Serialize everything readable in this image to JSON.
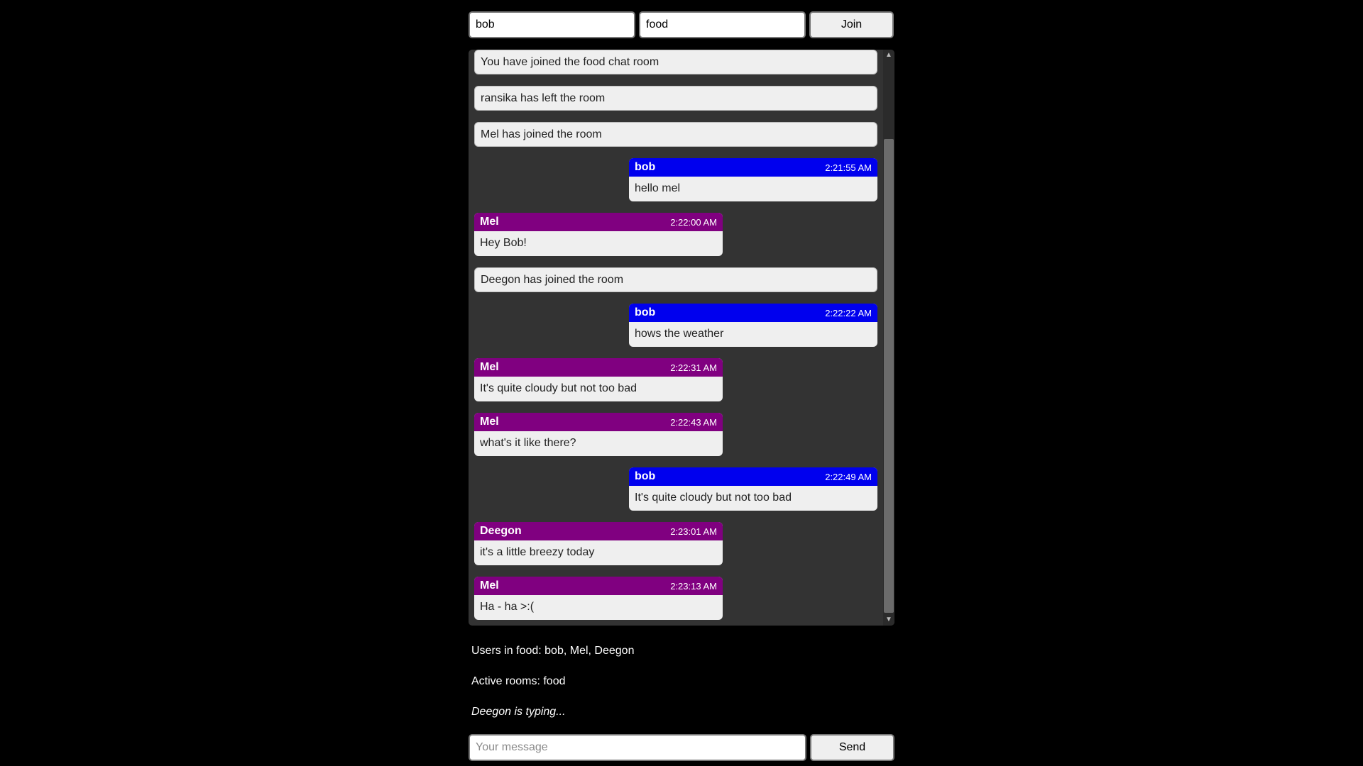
{
  "join": {
    "username_value": "bob",
    "room_value": "food",
    "join_label": "Join"
  },
  "messages": [
    {
      "kind": "notice",
      "text": "You have joined the food chat room"
    },
    {
      "kind": "notice",
      "text": "ransika has left the room"
    },
    {
      "kind": "notice",
      "text": "Mel has joined the room"
    },
    {
      "kind": "message",
      "side": "mine",
      "sender": "bob",
      "time": "2:21:55 AM",
      "text": "hello mel"
    },
    {
      "kind": "message",
      "side": "theirs",
      "sender": "Mel",
      "time": "2:22:00 AM",
      "text": "Hey Bob!"
    },
    {
      "kind": "notice",
      "text": "Deegon has joined the room"
    },
    {
      "kind": "message",
      "side": "mine",
      "sender": "bob",
      "time": "2:22:22 AM",
      "text": "hows the weather"
    },
    {
      "kind": "message",
      "side": "theirs",
      "sender": "Mel",
      "time": "2:22:31 AM",
      "text": "It's quite cloudy but not too bad"
    },
    {
      "kind": "message",
      "side": "theirs",
      "sender": "Mel",
      "time": "2:22:43 AM",
      "text": "what's it like there?"
    },
    {
      "kind": "message",
      "side": "mine",
      "sender": "bob",
      "time": "2:22:49 AM",
      "text": "It's quite cloudy but not too bad"
    },
    {
      "kind": "message",
      "side": "theirs",
      "sender": "Deegon",
      "time": "2:23:01 AM",
      "text": "it's a little breezy today"
    },
    {
      "kind": "message",
      "side": "theirs",
      "sender": "Mel",
      "time": "2:23:13 AM",
      "text": "Ha - ha >:("
    }
  ],
  "info": {
    "users_text": "Users in food: bob, Mel, Deegon",
    "rooms_text": "Active rooms: food",
    "typing_text": "Deegon is typing..."
  },
  "composer": {
    "placeholder": "Your message",
    "send_label": "Send"
  },
  "colors": {
    "own_header": "#0000ee",
    "other_header": "#800080",
    "chat_background": "#333333",
    "page_background": "#000000"
  },
  "icons": {
    "scroll_up": "scroll-up-arrow-icon",
    "scroll_down": "scroll-down-arrow-icon"
  }
}
